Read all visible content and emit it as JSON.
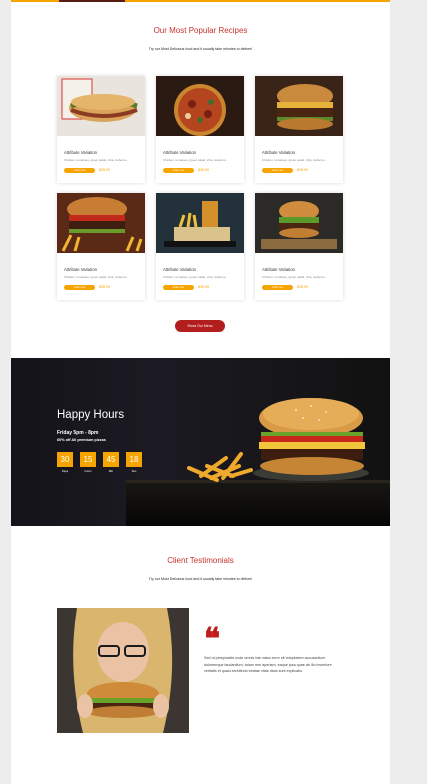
{
  "popular": {
    "title": "Our Most Popular Recipes",
    "subtitle": "Try our Most Delicious food and it usually take minutes to deliver!",
    "cards": [
      {
        "name": "Attribute Variation",
        "desc": "Chicken, tomatoes, green salad, chia, iceberus...",
        "order": "order now",
        "price": "$35.99",
        "icon": "sandwich-image"
      },
      {
        "name": "Attribute Variation",
        "desc": "Chicken, tomatoes, green salad, chia, iceberus...",
        "order": "order now",
        "price": "$35.99",
        "icon": "pizza-image"
      },
      {
        "name": "Attribute Variation",
        "desc": "Chicken, tomatoes, green salad, chia, iceberus...",
        "order": "order now",
        "price": "$35.99",
        "icon": "burger-image"
      },
      {
        "name": "Attribute Variation",
        "desc": "Chicken, tomatoes, green salad, chia, iceberus...",
        "order": "order now",
        "price": "$35.99",
        "icon": "burger-fries-image"
      },
      {
        "name": "Attribute Variation",
        "desc": "Chicken, tomatoes, green salad, chia, iceberus...",
        "order": "order now",
        "price": "$35.99",
        "icon": "drink-fries-image"
      },
      {
        "name": "Attribute Variation",
        "desc": "Chicken, tomatoes, green salad, chia, iceberus...",
        "order": "order now",
        "price": "$35.99",
        "icon": "burger-board-image"
      }
    ],
    "menu_button": "Show Our Menu"
  },
  "happy_hours": {
    "title": "Happy Hours",
    "time": "Friday 5pm - 8pm",
    "offer": "60% off All premium pizzas",
    "countdown": [
      {
        "value": "30",
        "label": "Days"
      },
      {
        "value": "15",
        "label": "hours"
      },
      {
        "value": "45",
        "label": "Min"
      },
      {
        "value": "18",
        "label": "Sec"
      }
    ]
  },
  "testimonials": {
    "title": "Client Testimonials",
    "subtitle": "Try our Most Delicious food and it usually take minutes to deliver!",
    "quote_mark": "❝",
    "text": "Sed ut perspiciatis unde omnis iste natus error sit voluptatem accusantium doloremque laudantium, totam rem aperiam, eaque ipsa quae ab illo inventore veritatis et quasi architecto beatae vitae dicta sunt explicabo."
  },
  "colors": {
    "accent": "#f5a400",
    "brand_red": "#c8332b",
    "button_red": "#b21e1e"
  }
}
